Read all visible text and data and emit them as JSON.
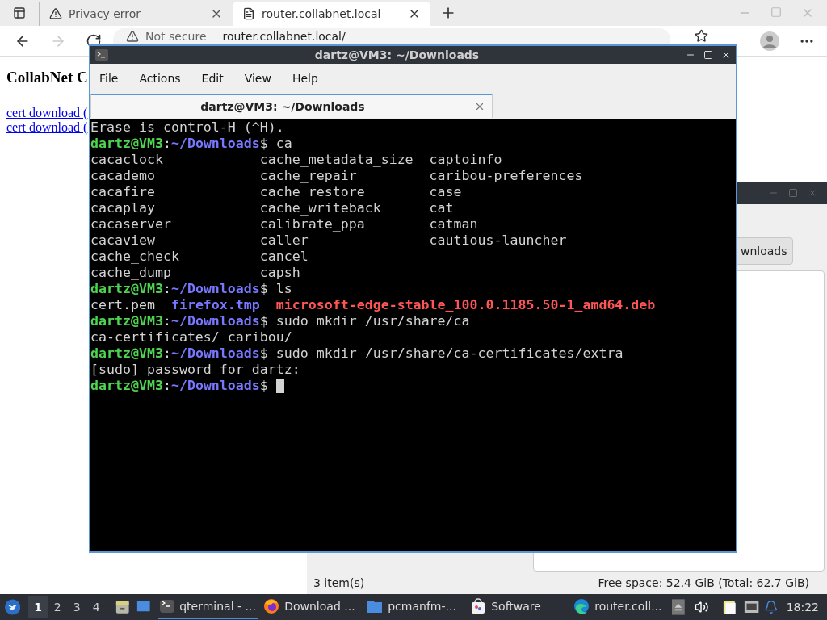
{
  "browser": {
    "tabs": [
      {
        "title": "Privacy error",
        "kind": "warning",
        "selected": false
      },
      {
        "title": "router.collabnet.local",
        "kind": "page",
        "selected": true
      }
    ],
    "address": {
      "security": "Not secure",
      "url": "router.collabnet.local/"
    },
    "page": {
      "heading": "CollabNet C",
      "links": [
        "cert download (",
        "cert download ("
      ]
    }
  },
  "file_manager": {
    "path_button": "wnloads",
    "status": {
      "items": "3 item(s)",
      "free_space": "Free space: 52.4 GiB (Total: 62.7 GiB)"
    }
  },
  "terminal": {
    "title": "dartz@VM3: ~/Downloads",
    "menu": [
      "File",
      "Actions",
      "Edit",
      "View",
      "Help"
    ],
    "tabs": [
      {
        "title": "dartz@VM3: ~/Downloads",
        "selected": true
      }
    ],
    "lines": [
      [
        {
          "text": "Erase is control-H (^H).",
          "kind": "plain"
        }
      ],
      [
        {
          "text": "dartz@VM3",
          "kind": "user"
        },
        {
          "text": ":",
          "kind": "plain"
        },
        {
          "text": "~/Downloads",
          "kind": "path"
        },
        {
          "text": "$ ca",
          "kind": "plain"
        }
      ],
      [
        {
          "text": "cacaclock            cache_metadata_size  captoinfo",
          "kind": "plain"
        }
      ],
      [
        {
          "text": "cacademo             cache_repair         caribou-preferences",
          "kind": "plain"
        }
      ],
      [
        {
          "text": "cacafire             cache_restore        case",
          "kind": "plain"
        }
      ],
      [
        {
          "text": "cacaplay             cache_writeback      cat",
          "kind": "plain"
        }
      ],
      [
        {
          "text": "cacaserver           calibrate_ppa        catman",
          "kind": "plain"
        }
      ],
      [
        {
          "text": "cacaview             caller               cautious-launcher",
          "kind": "plain"
        }
      ],
      [
        {
          "text": "cache_check          cancel",
          "kind": "plain"
        }
      ],
      [
        {
          "text": "cache_dump           capsh",
          "kind": "plain"
        }
      ],
      [
        {
          "text": "dartz@VM3",
          "kind": "user"
        },
        {
          "text": ":",
          "kind": "plain"
        },
        {
          "text": "~/Downloads",
          "kind": "path"
        },
        {
          "text": "$ ls",
          "kind": "plain"
        }
      ],
      [
        {
          "text": "cert.pem  ",
          "kind": "plain"
        },
        {
          "text": "firefox.tmp  ",
          "kind": "dir"
        },
        {
          "text": "microsoft-edge-stable_100.0.1185.50-1_amd64.deb",
          "kind": "archive"
        }
      ],
      [
        {
          "text": "dartz@VM3",
          "kind": "user"
        },
        {
          "text": ":",
          "kind": "plain"
        },
        {
          "text": "~/Downloads",
          "kind": "path"
        },
        {
          "text": "$ sudo mkdir /usr/share/ca",
          "kind": "plain"
        }
      ],
      [
        {
          "text": "ca-certificates/ caribou/",
          "kind": "plain"
        }
      ],
      [
        {
          "text": "dartz@VM3",
          "kind": "user"
        },
        {
          "text": ":",
          "kind": "plain"
        },
        {
          "text": "~/Downloads",
          "kind": "path"
        },
        {
          "text": "$ sudo mkdir /usr/share/ca-certificates/extra",
          "kind": "plain"
        }
      ],
      [
        {
          "text": "[sudo] password for dartz:",
          "kind": "plain"
        }
      ],
      [
        {
          "text": "dartz@VM3",
          "kind": "user"
        },
        {
          "text": ":",
          "kind": "plain"
        },
        {
          "text": "~/Downloads",
          "kind": "path"
        },
        {
          "text": "$ ",
          "kind": "plain"
        }
      ]
    ],
    "cursor": true
  },
  "taskbar": {
    "workspaces": [
      {
        "label": "1",
        "selected": true
      },
      {
        "label": "2",
        "selected": false
      },
      {
        "label": "3",
        "selected": false
      },
      {
        "label": "4",
        "selected": false
      }
    ],
    "tasks": [
      {
        "label": "qterminal - ...",
        "kind": "terminal",
        "selected": true
      },
      {
        "label": "Download ...",
        "kind": "firefox",
        "selected": false
      },
      {
        "label": "pcmanfm-...",
        "kind": "folder",
        "selected": false
      },
      {
        "label": "Software",
        "kind": "store",
        "selected": false
      },
      {
        "label": "router.coll...",
        "kind": "edge",
        "selected": false
      }
    ],
    "clock": "18:22"
  }
}
